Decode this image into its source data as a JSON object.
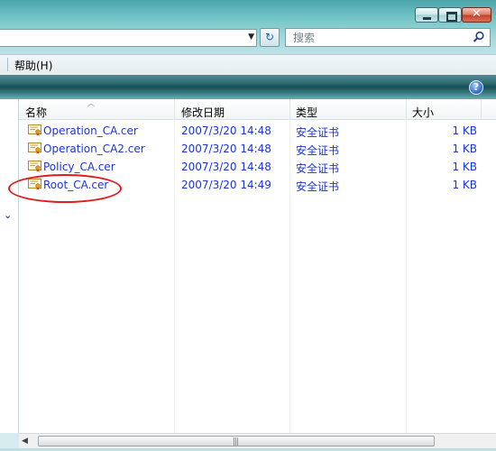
{
  "search": {
    "placeholder": "搜索"
  },
  "menu": {
    "help_label": "帮助(H)"
  },
  "help_icon_text": "?",
  "columns": {
    "name": "名称",
    "modified": "修改日期",
    "type": "类型",
    "size": "大小"
  },
  "files": [
    {
      "name": "Operation_CA.cer",
      "modified": "2007/3/20 14:48",
      "type": "安全证书",
      "size": "1 KB"
    },
    {
      "name": "Operation_CA2.cer",
      "modified": "2007/3/20 14:48",
      "type": "安全证书",
      "size": "1 KB"
    },
    {
      "name": "Policy_CA.cer",
      "modified": "2007/3/20 14:48",
      "type": "安全证书",
      "size": "1 KB"
    },
    {
      "name": "Root_CA.cer",
      "modified": "2007/3/20 14:49",
      "type": "安全证书",
      "size": "1 KB"
    }
  ],
  "icons": {
    "file": "certificate-file-icon",
    "search": "search-icon",
    "refresh": "refresh-icon",
    "help": "help-icon"
  },
  "colors": {
    "file_text": "#1a35d6",
    "highlight_ellipse": "#e11b1b",
    "toolbar": "#1a4f55"
  }
}
